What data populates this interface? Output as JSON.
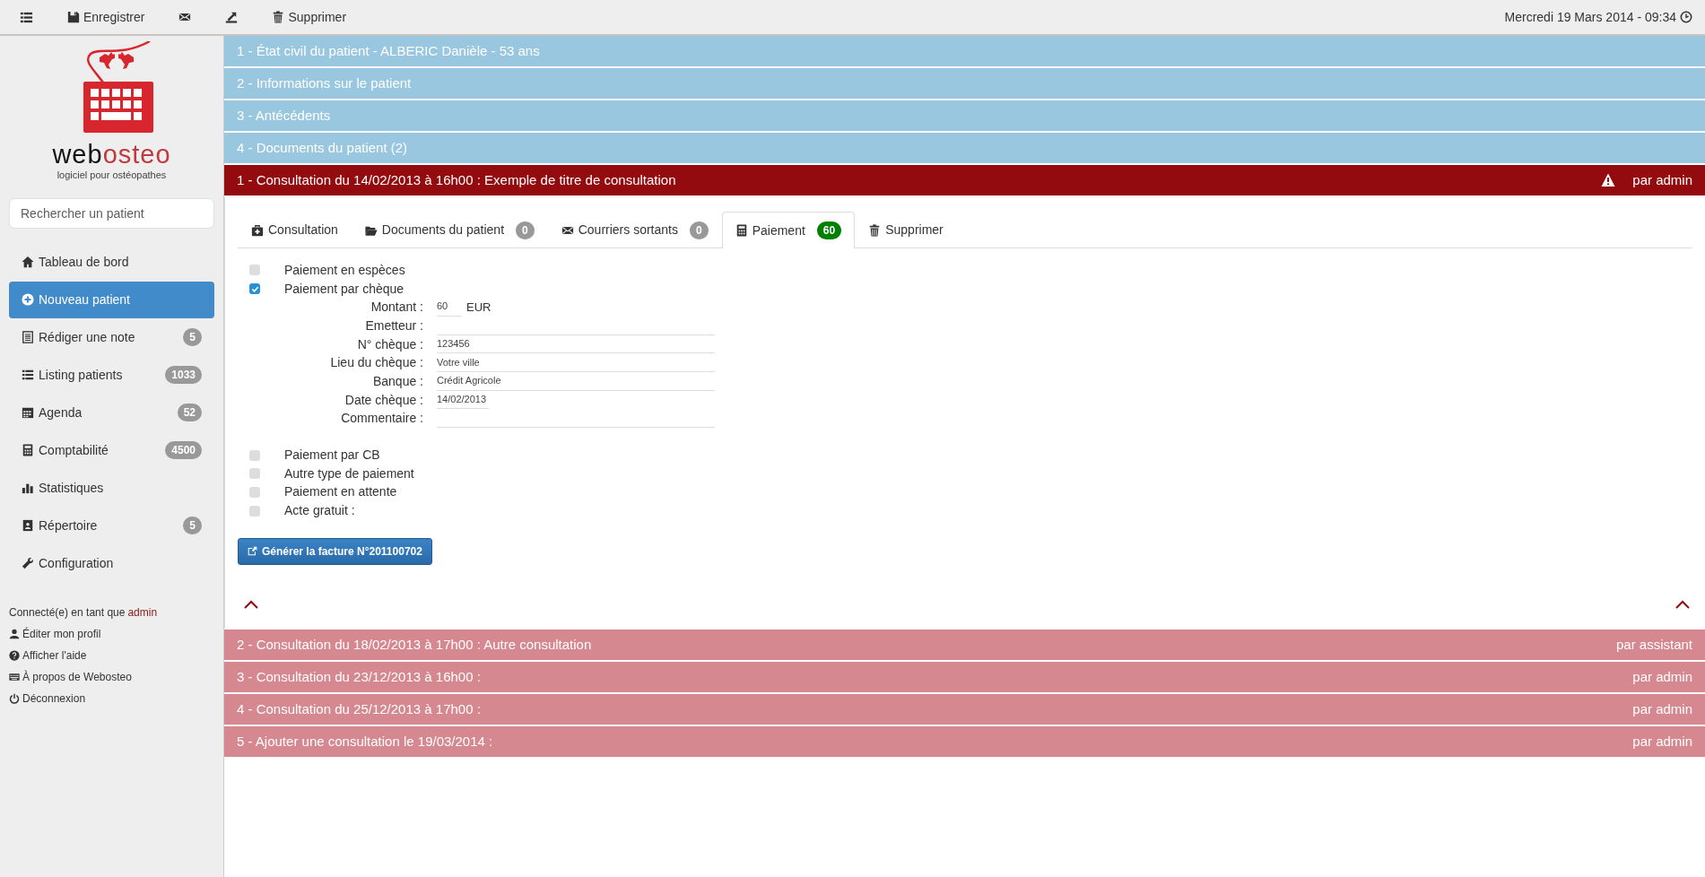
{
  "toolbar": {
    "items": [
      {
        "kind": "menu"
      },
      {
        "kind": "save",
        "label": "Enregistrer"
      },
      {
        "kind": "mail"
      },
      {
        "kind": "export"
      },
      {
        "kind": "delete",
        "label": "Supprimer"
      }
    ],
    "datetime": "Mercredi 19 Mars 2014 - 09:34"
  },
  "sidebar": {
    "brand": {
      "part_1": "web",
      "part_2": "osteo",
      "tagline": "logiciel pour ostéopathes"
    },
    "search": {
      "placeholder": "Rechercher un patient"
    },
    "items": [
      {
        "label": "Tableau de bord",
        "selected": false
      },
      {
        "label": "Nouveau patient",
        "selected": true
      },
      {
        "label": "Rédiger une note",
        "badge": "5",
        "selected": false
      },
      {
        "label": "Listing patients",
        "badge": "1033",
        "selected": false
      },
      {
        "label": "Agenda",
        "badge": "52",
        "selected": false
      },
      {
        "label": "Comptabilité",
        "badge": "4500",
        "selected": false
      },
      {
        "label": "Statistiques",
        "selected": false
      },
      {
        "label": "Répertoire",
        "badge": "5",
        "selected": false
      },
      {
        "label": "Configuration",
        "selected": false
      }
    ],
    "user": {
      "prefix": "Connecté(e) en tant que",
      "name": "admin"
    },
    "links": [
      "Éditer mon profil",
      "Afficher l'aide",
      "À propos de Webosteo",
      "Déconnexion"
    ]
  },
  "patient_sections": [
    "1 - État civil du patient - ALBERIC Danièle - 53 ans",
    "2 - Informations sur le patient",
    "3 - Antécédents",
    "4 - Documents du patient (2)"
  ],
  "consultations": [
    {
      "title": "1 - Consultation du 14/02/2013 à 16h00 : Exemple de titre de consultation",
      "author": "par admin",
      "expanded": true,
      "warning": true
    },
    {
      "title": "2 - Consultation du 18/02/2013 à 17h00 : Autre consultation",
      "author": "par assistant",
      "expanded": false,
      "warning": false
    },
    {
      "title": "3 - Consultation du 23/12/2013 à 16h00 :",
      "author": "par admin",
      "expanded": false,
      "warning": false
    },
    {
      "title": "4 - Consultation du 25/12/2013 à 17h00 :",
      "author": "par admin",
      "expanded": false,
      "warning": false
    },
    {
      "title": "5 - Ajouter une consultation le 19/03/2014 :",
      "author": "par admin",
      "expanded": false,
      "warning": false
    }
  ],
  "tabs": [
    {
      "label": "Consultation",
      "selected": false
    },
    {
      "label": "Documents du patient",
      "badge": "0",
      "color": "#999999",
      "selected": false
    },
    {
      "label": "Courriers sortants",
      "badge": "0",
      "color": "#999999",
      "selected": false
    },
    {
      "label": "Paiement",
      "badge": "60",
      "color": "#008000",
      "selected": true
    },
    {
      "label": "Supprimer",
      "selected": false
    }
  ],
  "payment": {
    "options": [
      {
        "label": "Paiement en espèces",
        "checked": false
      },
      {
        "label": "Paiement par chèque",
        "checked": true,
        "fields": [
          {
            "label": "Montant :",
            "value": "60",
            "unit": "EUR",
            "kind": "short"
          },
          {
            "label": "Emetteur :",
            "kind": "long"
          },
          {
            "label": "N° chèque :",
            "value": "123456",
            "kind": "long"
          },
          {
            "label": "Lieu du chèque :",
            "value": "Votre ville",
            "kind": "long"
          },
          {
            "label": "Banque :",
            "value": "Crédit Agricole",
            "kind": "long"
          },
          {
            "label": "Date chèque :",
            "value": "14/02/2013",
            "kind": "medium"
          },
          {
            "label": "Commentaire :",
            "kind": "long"
          }
        ]
      },
      {
        "label": "Paiement par CB",
        "checked": false
      },
      {
        "label": "Autre type de paiement",
        "checked": false
      },
      {
        "label": "Paiement en attente",
        "checked": false
      },
      {
        "label": "Acte gratuit :",
        "checked": false
      }
    ],
    "invoice_button": "Générer la facture N°201100702"
  }
}
